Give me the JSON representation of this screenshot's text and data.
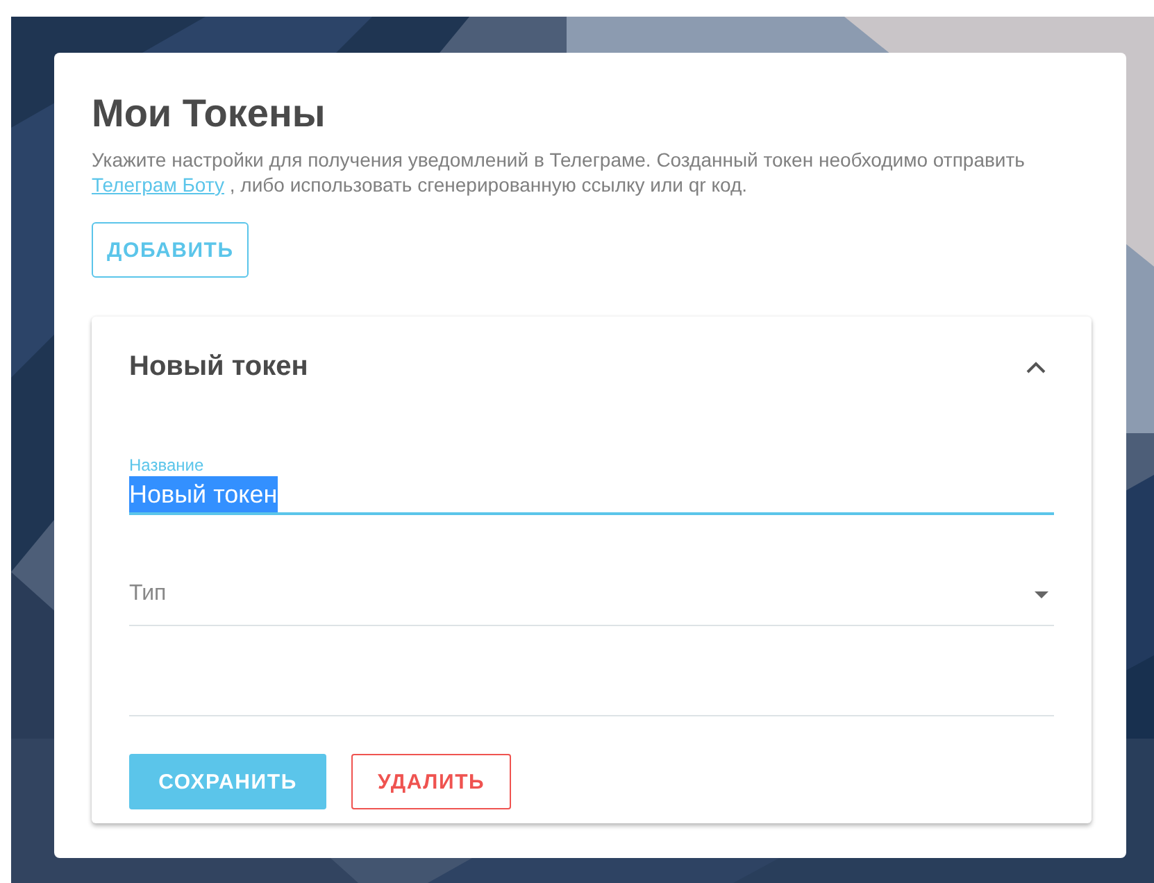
{
  "page": {
    "title": "Мои Токены",
    "description": {
      "before": "Укажите настройки для получения уведомлений в Телеграме. Созданный токен необходимо отправить",
      "link": "Телеграм Боту",
      "after": ", либо использовать сгенерированную ссылку или qr код."
    },
    "add_button": "ДОБАВИТЬ"
  },
  "token_panel": {
    "title": "Новый токен",
    "expanded": true,
    "fields": [
      {
        "kind": "text",
        "label": "Название",
        "value": "Новый токен",
        "focused": true,
        "value_selected": true
      },
      {
        "kind": "select",
        "label": "Тип",
        "focused": false
      }
    ],
    "buttons": [
      {
        "kind": "primary",
        "label": "СОХРАНИТЬ"
      },
      {
        "kind": "danger",
        "label": "УДАЛИТЬ"
      }
    ]
  }
}
